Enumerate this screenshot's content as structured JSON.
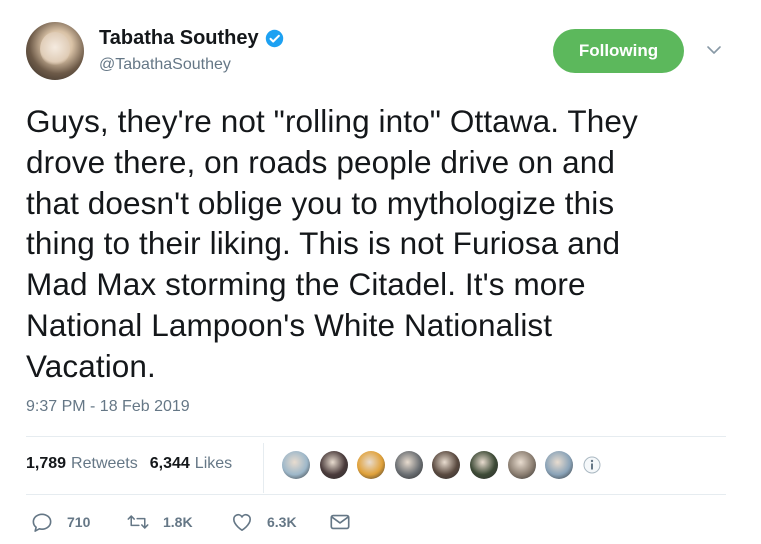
{
  "author": {
    "name": "Tabatha Southey",
    "handle": "@TabathaSouthey",
    "verified": true
  },
  "follow_button": {
    "label": "Following",
    "color": "#5cb85c"
  },
  "tweet": {
    "text": "Guys, they're not \"rolling into\" Ottawa. They\ndrove there, on roads people drive on and\nthat doesn't oblige you to mythologize this\nthing to their liking. This is not Furiosa and\nMad Max storming the Citadel. It's more\nNational Lampoon's White Nationalist\nVacation.",
    "timestamp": "9:37 PM - 18 Feb 2019"
  },
  "stats": {
    "retweets_count": "1,789",
    "retweets_label": "Retweets",
    "likes_count": "6,344",
    "likes_label": "Likes"
  },
  "liker_avatars": [
    {
      "color": "#9db7c9"
    },
    {
      "color": "#4a3b3b"
    },
    {
      "color": "#e0a13a"
    },
    {
      "color": "#6b6f73"
    },
    {
      "color": "#5a4a40"
    },
    {
      "color": "#3d4a36"
    },
    {
      "color": "#8c7f72"
    },
    {
      "color": "#8aa3b8"
    }
  ],
  "actions": {
    "replies": "710",
    "retweets": "1.8K",
    "likes": "6.3K"
  },
  "colors": {
    "text": "#14171a",
    "secondary": "#657786",
    "verified": "#1da1f2",
    "divider": "#e6ecf0"
  }
}
